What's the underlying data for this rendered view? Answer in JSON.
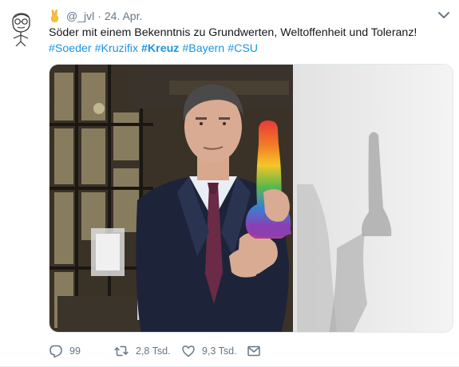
{
  "tweet": {
    "handle": "@_jvl",
    "separator": "·",
    "date": "24. Apr.",
    "text": "Söder mit einem Bekenntnis zu Grundwerten, Weltoffenheit und Toleranz!",
    "hashtags": [
      {
        "label": "#Soeder"
      },
      {
        "label": "#Kruzifix"
      },
      {
        "label": "#Kreuz"
      },
      {
        "label": "#Bayern"
      },
      {
        "label": "#CSU"
      }
    ]
  },
  "actions": {
    "reply_count": "99",
    "retweet_count": "2,8 Tsd.",
    "like_count": "9,3 Tsd."
  },
  "icons": {
    "avatar": "sketch-face-avatar",
    "emoji": "victory-hand-emoji",
    "caret": "chevron-down-icon",
    "reply": "reply-icon",
    "retweet": "retweet-icon",
    "like": "heart-icon",
    "dm": "envelope-icon"
  },
  "colors": {
    "link": "#1b95e0",
    "secondary_text": "#657786",
    "primary_text": "#14171a"
  }
}
